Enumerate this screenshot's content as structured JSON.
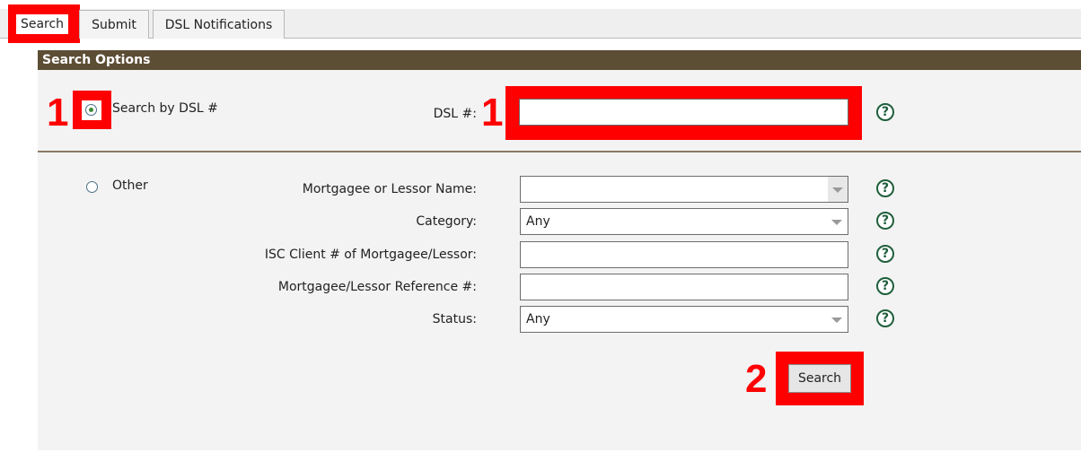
{
  "tabs": {
    "search": "Search",
    "submit": "Submit",
    "dsl_notifications": "DSL Notifications"
  },
  "panel": {
    "header": "Search Options"
  },
  "annotations": {
    "step1": "1",
    "step2": "2",
    "highlight_color": "#ff0000"
  },
  "search_by_dsl": {
    "radio_label": "Search by DSL #",
    "selected": true,
    "dsl_label": "DSL #:",
    "dsl_value": ""
  },
  "other": {
    "radio_label": "Other",
    "selected": false,
    "mortgagee_label": "Mortgagee or Lessor Name:",
    "mortgagee_value": "",
    "category_label": "Category:",
    "category_value": "Any",
    "isc_label": "ISC Client # of Mortgagee/Lessor:",
    "isc_value": "",
    "reference_label": "Mortgagee/Lessor Reference #:",
    "reference_value": "",
    "status_label": "Status:",
    "status_value": "Any"
  },
  "help_icon": "?",
  "search_button": "Search",
  "colors": {
    "header_bg": "#5c4d35",
    "panel_bg": "#f3f3f3",
    "help_icon": "#1f5f3c"
  }
}
